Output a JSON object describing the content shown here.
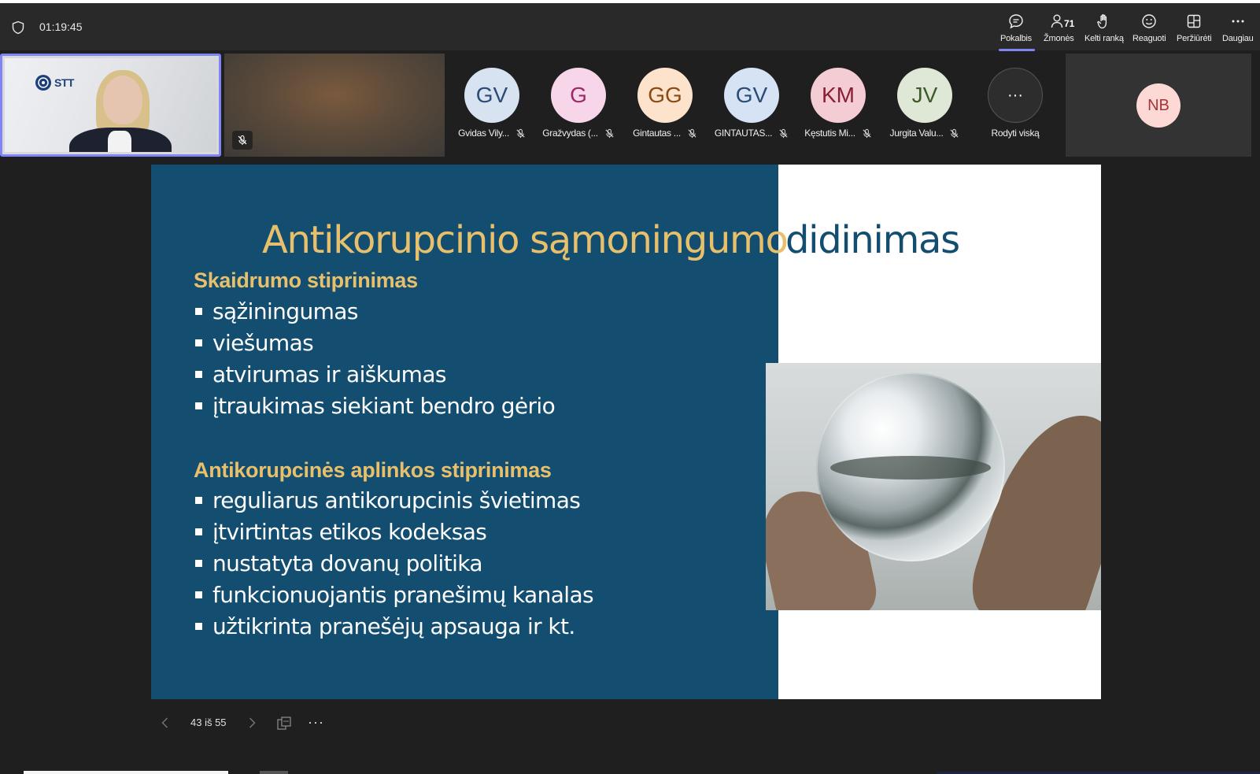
{
  "meeting": {
    "timer": "01:19:45"
  },
  "toolbar": {
    "chat_label": "Pokalbis",
    "people_label": "Žmonės",
    "people_count": "71",
    "raise_hand_label": "Kelti ranką",
    "react_label": "Reaguoti",
    "view_label": "Peržiūrėti",
    "more_label": "Daugiau"
  },
  "video_tiles": {
    "presenter_logo_text": "STT"
  },
  "participants": [
    {
      "initials": "GV",
      "name": "Gvidas Vily...",
      "bg": "#d7e3f1",
      "fg": "#2b4c75"
    },
    {
      "initials": "G",
      "name": "Gražvydas (...",
      "bg": "#f7d6ea",
      "fg": "#9b2a6a"
    },
    {
      "initials": "GG",
      "name": "Gintautas ...",
      "bg": "#fde2cc",
      "fg": "#8a4b14"
    },
    {
      "initials": "GV",
      "name": "GINTAUTAS...",
      "bg": "#d6e3f5",
      "fg": "#2b4c75"
    },
    {
      "initials": "KM",
      "name": "Kęstutis Mi...",
      "bg": "#f4ccd3",
      "fg": "#8a1e33"
    },
    {
      "initials": "JV",
      "name": "Jurgita Valu...",
      "bg": "#dfe8d6",
      "fg": "#3c5a2a"
    }
  ],
  "show_all": {
    "glyph": "···",
    "label": "Rodyti viską"
  },
  "extra_participant": {
    "initials": "NB"
  },
  "slide": {
    "title_part1": "Antikorupcinio sąmoningumo",
    "title_part2": "didinimas",
    "section1_heading": "Skaidrumo stiprinimas",
    "section1_items": [
      "sąžiningumas",
      "viešumas",
      "atvirumas ir aiškumas",
      "įtraukimas siekiant bendro gėrio"
    ],
    "section2_heading": "Antikorupcinės aplinkos stiprinimas",
    "section2_items": [
      "reguliarus antikorupcinis švietimas",
      "įtvirtintas etikos kodeksas",
      "nustatyta dovanų politika",
      "funkcionuojantis pranešimų kanalas",
      "užtikrinta pranešėjų apsauga ir kt."
    ]
  },
  "slide_controls": {
    "page_indicator": "43 iš 55",
    "more_glyph": "···"
  },
  "colors": {
    "accent": "#7f85f5",
    "slide_blue": "#134d70",
    "slide_gold": "#e8c06c"
  }
}
